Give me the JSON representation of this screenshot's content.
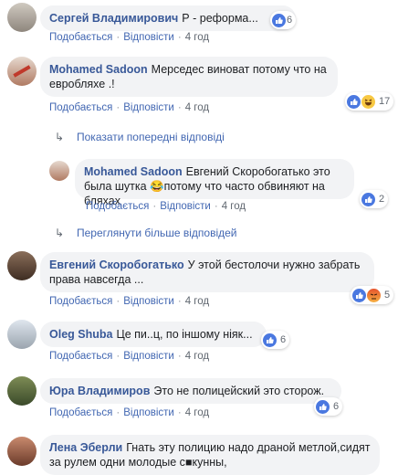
{
  "comments": [
    {
      "author": "Сергей Владимирович",
      "text": "Р - реформа...",
      "like": "Подобається",
      "reply": "Відповісти",
      "time": "4 год",
      "count": "6"
    },
    {
      "author": "Mohamed Sadoon",
      "text": "Мерседес виноват потому что на евробляхе .!",
      "like": "Подобається",
      "reply": "Відповісти",
      "time": "4 год",
      "count": "17"
    },
    {
      "author": "Mohamed Sadoon",
      "text": "Евгений Скоробогатько это была шутка",
      "text2": "потому что часто обвиняют на бляхах",
      "emoji": "😂",
      "like": "Подобається",
      "reply": "Відповісти",
      "time": "4 год",
      "count": "2"
    },
    {
      "author": "Евгений Скоробогатько",
      "text": "У этой бестолочи нужно забрать права навсегда ...",
      "like": "Подобається",
      "reply": "Відповісти",
      "time": "4 год",
      "count": "5"
    },
    {
      "author": "Oleg Shuba",
      "text": "Це пи..ц, по іншому ніяк...",
      "like": "Подобається",
      "reply": "Відповісти",
      "time": "4 год",
      "count": "6"
    },
    {
      "author": "Юра Владимиров",
      "text": "Это не полицейский это сторож.",
      "like": "Подобається",
      "reply": "Відповісти",
      "time": "4 год",
      "count": "6"
    },
    {
      "author": "Лена Эберли",
      "text": "Гнать эту полицию надо драной метлой,сидят за рулем одни молодые с",
      "censor": "■",
      "text_end": "кунны,"
    }
  ],
  "links": {
    "show_previous": "Показати попередні відповіді",
    "view_more": "Переглянути більше відповідей"
  },
  "colors": {
    "link": "#385898",
    "bubble": "#f2f3f5",
    "like": "#4a78e0"
  }
}
